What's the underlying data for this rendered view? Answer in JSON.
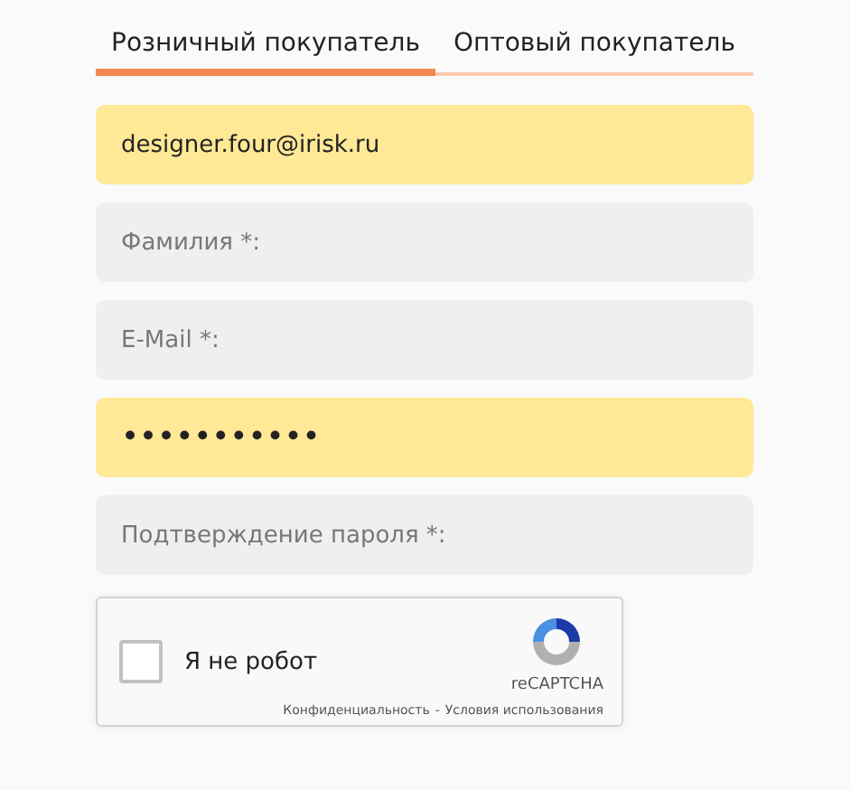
{
  "tabs": [
    {
      "label": "Розничный покупатель",
      "selected": true
    },
    {
      "label": "Оптовый покупатель",
      "selected": false
    }
  ],
  "fields": [
    {
      "kind": "text",
      "value": "designer.four@irisk.ru",
      "highlighted": true
    },
    {
      "kind": "text",
      "placeholder": "Фамилия *:",
      "highlighted": false
    },
    {
      "kind": "text",
      "placeholder": "E-Mail *:",
      "highlighted": false
    },
    {
      "kind": "password",
      "value": "•••••••••••",
      "highlighted": true
    },
    {
      "kind": "password",
      "placeholder": "Подтверждение пароля *:",
      "highlighted": false
    }
  ],
  "captcha": {
    "label": "Я не робот",
    "checked": false,
    "brand": "reCAPTCHA",
    "privacy": "Конфиденциальность",
    "separator": "-",
    "terms": "Условия использования"
  }
}
